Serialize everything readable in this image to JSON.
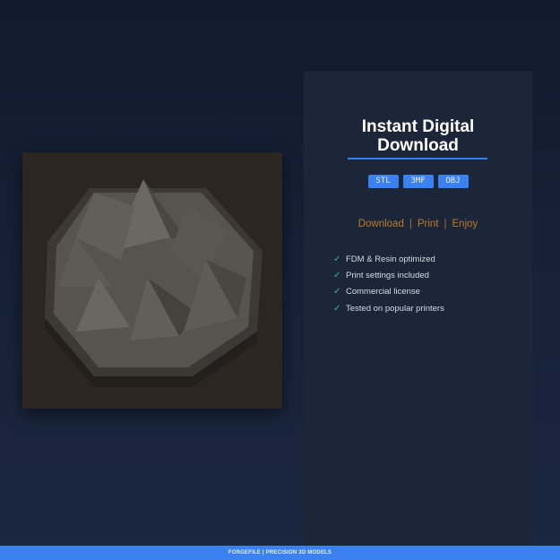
{
  "product_image": {
    "alt": "3D printed crystal cluster terrain model on octagonal base"
  },
  "panel": {
    "title_line1": "Instant Digital",
    "title_line2": "Download",
    "formats": [
      "STL",
      "3MF",
      "OBJ"
    ],
    "tagline": [
      "Download",
      "Print",
      "Enjoy"
    ],
    "tagline_separator": "|",
    "features": [
      "FDM & Resin optimized",
      "Print settings included",
      "Commercial license",
      "Tested on popular printers"
    ],
    "check_icon": "✓"
  },
  "footer": {
    "text": "FORGEFILE | PRECISION 3D MODELS"
  },
  "colors": {
    "accent": "#3b82f0",
    "tagline": "#c07a2a",
    "check": "#3bb89a"
  }
}
